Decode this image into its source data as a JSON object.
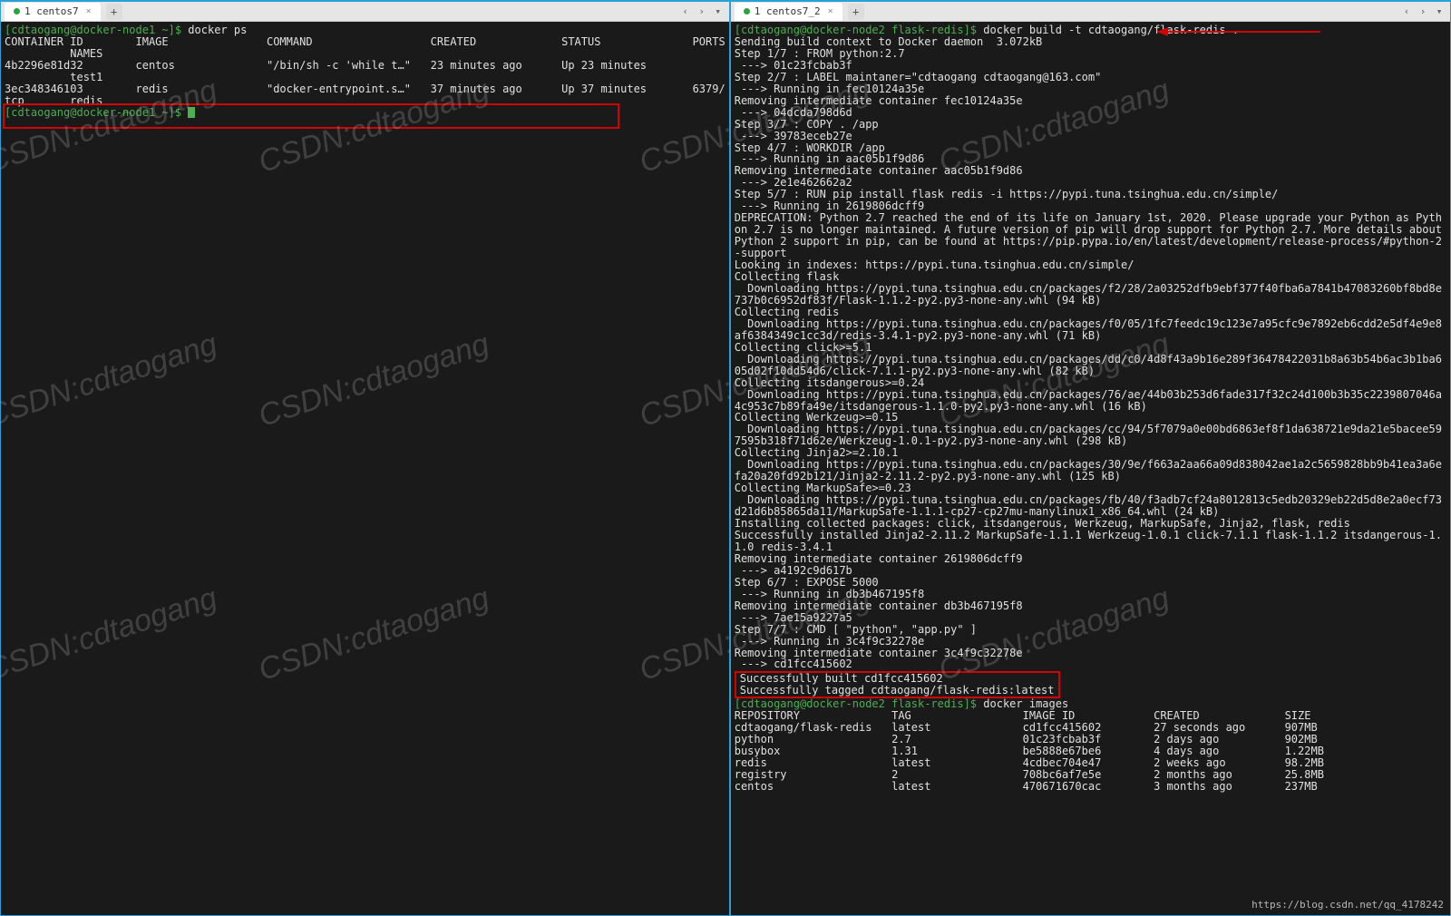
{
  "left": {
    "tab": {
      "label": "1 centos7"
    },
    "prompt1": "[cdtaogang@docker-node1 ~]$ ",
    "cmd1": "docker ps",
    "col": {
      "containerId": "CONTAINER ID",
      "image": "IMAGE",
      "command": "COMMAND",
      "created": "CREATED",
      "status": "STATUS",
      "ports": "PORTS",
      "names": "NAMES"
    },
    "row1": {
      "id": "4b2296e81d32",
      "image": "centos",
      "cmd": "\"/bin/sh -c 'while t…\"",
      "created": "23 minutes ago",
      "status": "Up 23 minutes",
      "ports": "",
      "names": "test1"
    },
    "row2": {
      "id": "3ec348346103",
      "image": "redis",
      "cmd": "\"docker-entrypoint.s…\"",
      "created": "37 minutes ago",
      "status": "Up 37 minutes",
      "ports": "6379/",
      "tcp": "tcp",
      "names": "redis"
    },
    "prompt2": "[cdtaogang@docker-node1 ~]$ "
  },
  "right": {
    "tab": {
      "label": "1 centos7_2"
    },
    "prompt1": "[cdtaogang@docker-node2 flask-redis]$ ",
    "cmd1": "docker build -t cdtaogang/flask-redis .",
    "build_lines": [
      "Sending build context to Docker daemon  3.072kB",
      "Step 1/7 : FROM python:2.7",
      " ---> 01c23fcbab3f",
      "Step 2/7 : LABEL maintaner=\"cdtaogang cdtaogang@163.com\"",
      " ---> Running in fec10124a35e",
      "Removing intermediate container fec10124a35e",
      " ---> 04dcda798d6d",
      "Step 3/7 : COPY . /app",
      " ---> 39783eceb27e",
      "Step 4/7 : WORKDIR /app",
      " ---> Running in aac05b1f9d86",
      "Removing intermediate container aac05b1f9d86",
      " ---> 2e1e462662a2",
      "Step 5/7 : RUN pip install flask redis -i https://pypi.tuna.tsinghua.edu.cn/simple/",
      " ---> Running in 2619806dcff9",
      "DEPRECATION: Python 2.7 reached the end of its life on January 1st, 2020. Please upgrade your Python as Python 2.7 is no longer maintained. A future version of pip will drop support for Python 2.7. More details about Python 2 support in pip, can be found at https://pip.pypa.io/en/latest/development/release-process/#python-2-support",
      "Looking in indexes: https://pypi.tuna.tsinghua.edu.cn/simple/",
      "Collecting flask",
      "  Downloading https://pypi.tuna.tsinghua.edu.cn/packages/f2/28/2a03252dfb9ebf377f40fba6a7841b47083260bf8bd8e737b0c6952df83f/Flask-1.1.2-py2.py3-none-any.whl (94 kB)",
      "Collecting redis",
      "  Downloading https://pypi.tuna.tsinghua.edu.cn/packages/f0/05/1fc7feedc19c123e7a95cfc9e7892eb6cdd2e5df4e9e8af6384349c1cc3d/redis-3.4.1-py2.py3-none-any.whl (71 kB)",
      "Collecting click>=5.1",
      "  Downloading https://pypi.tuna.tsinghua.edu.cn/packages/dd/c0/4d8f43a9b16e289f36478422031b8a63b54b6ac3b1ba605d02f10dd54d6/click-7.1.1-py2.py3-none-any.whl (82 kB)",
      "Collecting itsdangerous>=0.24",
      "  Downloading https://pypi.tuna.tsinghua.edu.cn/packages/76/ae/44b03b253d6fade317f32c24d100b3b35c2239807046a4c953c7b89fa49e/itsdangerous-1.1.0-py2.py3-none-any.whl (16 kB)",
      "Collecting Werkzeug>=0.15",
      "  Downloading https://pypi.tuna.tsinghua.edu.cn/packages/cc/94/5f7079a0e00bd6863ef8f1da638721e9da21e5bacee597595b318f71d62e/Werkzeug-1.0.1-py2.py3-none-any.whl (298 kB)",
      "Collecting Jinja2>=2.10.1",
      "  Downloading https://pypi.tuna.tsinghua.edu.cn/packages/30/9e/f663a2aa66a09d838042ae1a2c5659828bb9b41ea3a6efa20a20fd92b121/Jinja2-2.11.2-py2.py3-none-any.whl (125 kB)",
      "Collecting MarkupSafe>=0.23",
      "  Downloading https://pypi.tuna.tsinghua.edu.cn/packages/fb/40/f3adb7cf24a8012813c5edb20329eb22d5d8e2a0ecf73d21d6b85865da11/MarkupSafe-1.1.1-cp27-cp27mu-manylinux1_x86_64.whl (24 kB)",
      "Installing collected packages: click, itsdangerous, Werkzeug, MarkupSafe, Jinja2, flask, redis",
      "Successfully installed Jinja2-2.11.2 MarkupSafe-1.1.1 Werkzeug-1.0.1 click-7.1.1 flask-1.1.2 itsdangerous-1.1.0 redis-3.4.1",
      "Removing intermediate container 2619806dcff9",
      " ---> a4192c9d617b",
      "Step 6/7 : EXPOSE 5000",
      " ---> Running in db3b467195f8",
      "Removing intermediate container db3b467195f8",
      " ---> 7ae15a9227a5",
      "Step 7/7 : CMD [ \"python\", \"app.py\" ]",
      " ---> Running in 3c4f9c32278e",
      "Removing intermediate container 3c4f9c32278e",
      " ---> cd1fcc415602"
    ],
    "success1": "Successfully built cd1fcc415602",
    "success2": "Successfully tagged cdtaogang/flask-redis:latest",
    "prompt2": "[cdtaogang@docker-node2 flask-redis]$ ",
    "cmd2": "docker images",
    "imgcol": {
      "repo": "REPOSITORY",
      "tag": "TAG",
      "id": "IMAGE ID",
      "created": "CREATED",
      "size": "SIZE"
    },
    "images": [
      {
        "repo": "cdtaogang/flask-redis",
        "tag": "latest",
        "id": "cd1fcc415602",
        "created": "27 seconds ago",
        "size": "907MB"
      },
      {
        "repo": "python",
        "tag": "2.7",
        "id": "01c23fcbab3f",
        "created": "2 days ago",
        "size": "902MB"
      },
      {
        "repo": "busybox",
        "tag": "1.31",
        "id": "be5888e67be6",
        "created": "4 days ago",
        "size": "1.22MB"
      },
      {
        "repo": "redis",
        "tag": "latest",
        "id": "4cdbec704e47",
        "created": "2 weeks ago",
        "size": "98.2MB"
      },
      {
        "repo": "registry",
        "tag": "2",
        "id": "708bc6af7e5e",
        "created": "2 months ago",
        "size": "25.8MB"
      },
      {
        "repo": "centos",
        "tag": "latest",
        "id": "470671670cac",
        "created": "3 months ago",
        "size": "237MB"
      }
    ]
  },
  "watermark": "CSDN:cdtaogang",
  "footer_url": "https://blog.csdn.net/qq_4178242"
}
